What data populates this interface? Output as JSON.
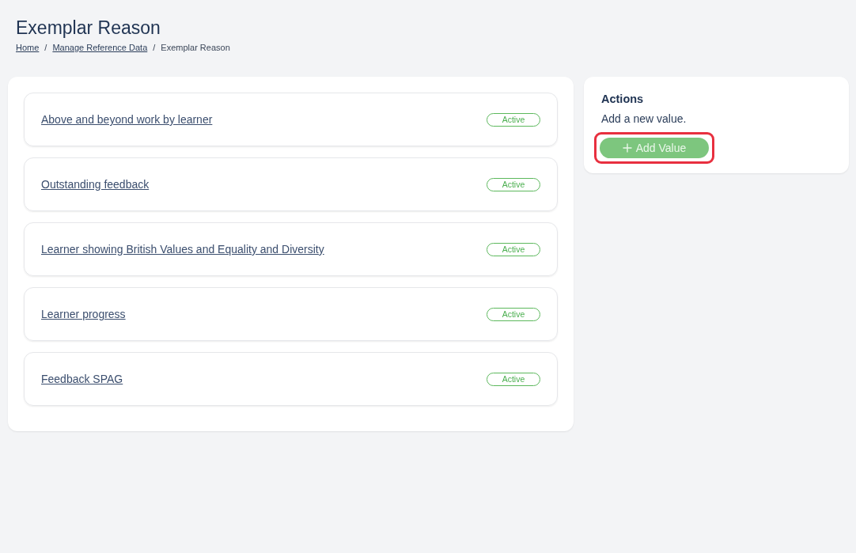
{
  "page": {
    "title": "Exemplar Reason"
  },
  "breadcrumb": [
    {
      "label": "Home",
      "kind": "link"
    },
    {
      "label": "/",
      "kind": "separator"
    },
    {
      "label": "Manage Reference Data",
      "kind": "link"
    },
    {
      "label": "/",
      "kind": "separator"
    },
    {
      "label": "Exemplar Reason",
      "kind": "current"
    }
  ],
  "values": [
    {
      "name": "Above and beyond work by learner",
      "status": "Active"
    },
    {
      "name": "Outstanding feedback",
      "status": "Active"
    },
    {
      "name": "Learner showing British Values and Equality and Diversity",
      "status": "Active"
    },
    {
      "name": "Learner progress",
      "status": "Active"
    },
    {
      "name": "Feedback SPAG",
      "status": "Active"
    }
  ],
  "actions": {
    "title": "Actions",
    "text": "Add a new value.",
    "button": {
      "label": "Add Value",
      "highlighted": true
    }
  }
}
